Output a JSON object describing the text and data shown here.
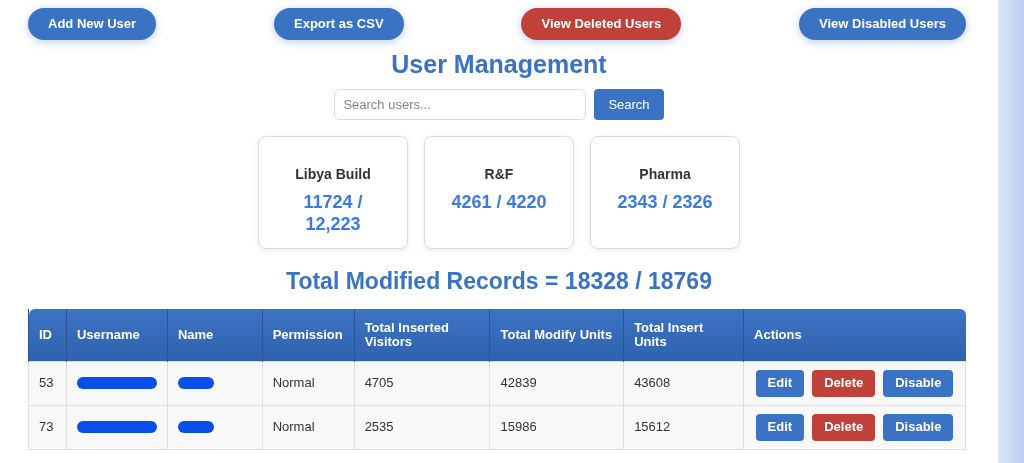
{
  "top_buttons": [
    {
      "label": "Add New User",
      "kind": "primary"
    },
    {
      "label": "Export as CSV",
      "kind": "primary"
    },
    {
      "label": "View Deleted Users",
      "kind": "danger"
    },
    {
      "label": "View Disabled Users",
      "kind": "primary"
    }
  ],
  "title": "User Management",
  "search": {
    "placeholder": "Search users...",
    "button": "Search"
  },
  "stat_cards": [
    {
      "label": "Libya Build",
      "value": "11724 / 12,223"
    },
    {
      "label": "R&F",
      "value": "4261 / 4220"
    },
    {
      "label": "Pharma",
      "value": "2343 / 2326"
    }
  ],
  "total": "Total Modified Records = 18328 / 18769",
  "table": {
    "columns": [
      "ID",
      "Username",
      "Name",
      "Permission",
      "Total Inserted Visitors",
      "Total Modify Units",
      "Total Insert Units",
      "Actions"
    ],
    "rows": [
      {
        "id": "53",
        "permission": "Normal",
        "inserted_visitors": "4705",
        "modify_units": "42839",
        "insert_units": "43608",
        "actions": [
          {
            "label": "Edit",
            "kind": "primary"
          },
          {
            "label": "Delete",
            "kind": "danger"
          },
          {
            "label": "Disable",
            "kind": "primary"
          }
        ]
      },
      {
        "id": "73",
        "permission": "Normal",
        "inserted_visitors": "2535",
        "modify_units": "15986",
        "insert_units": "15612",
        "actions": [
          {
            "label": "Edit",
            "kind": "primary"
          },
          {
            "label": "Delete",
            "kind": "danger"
          },
          {
            "label": "Disable",
            "kind": "primary"
          }
        ]
      }
    ]
  }
}
